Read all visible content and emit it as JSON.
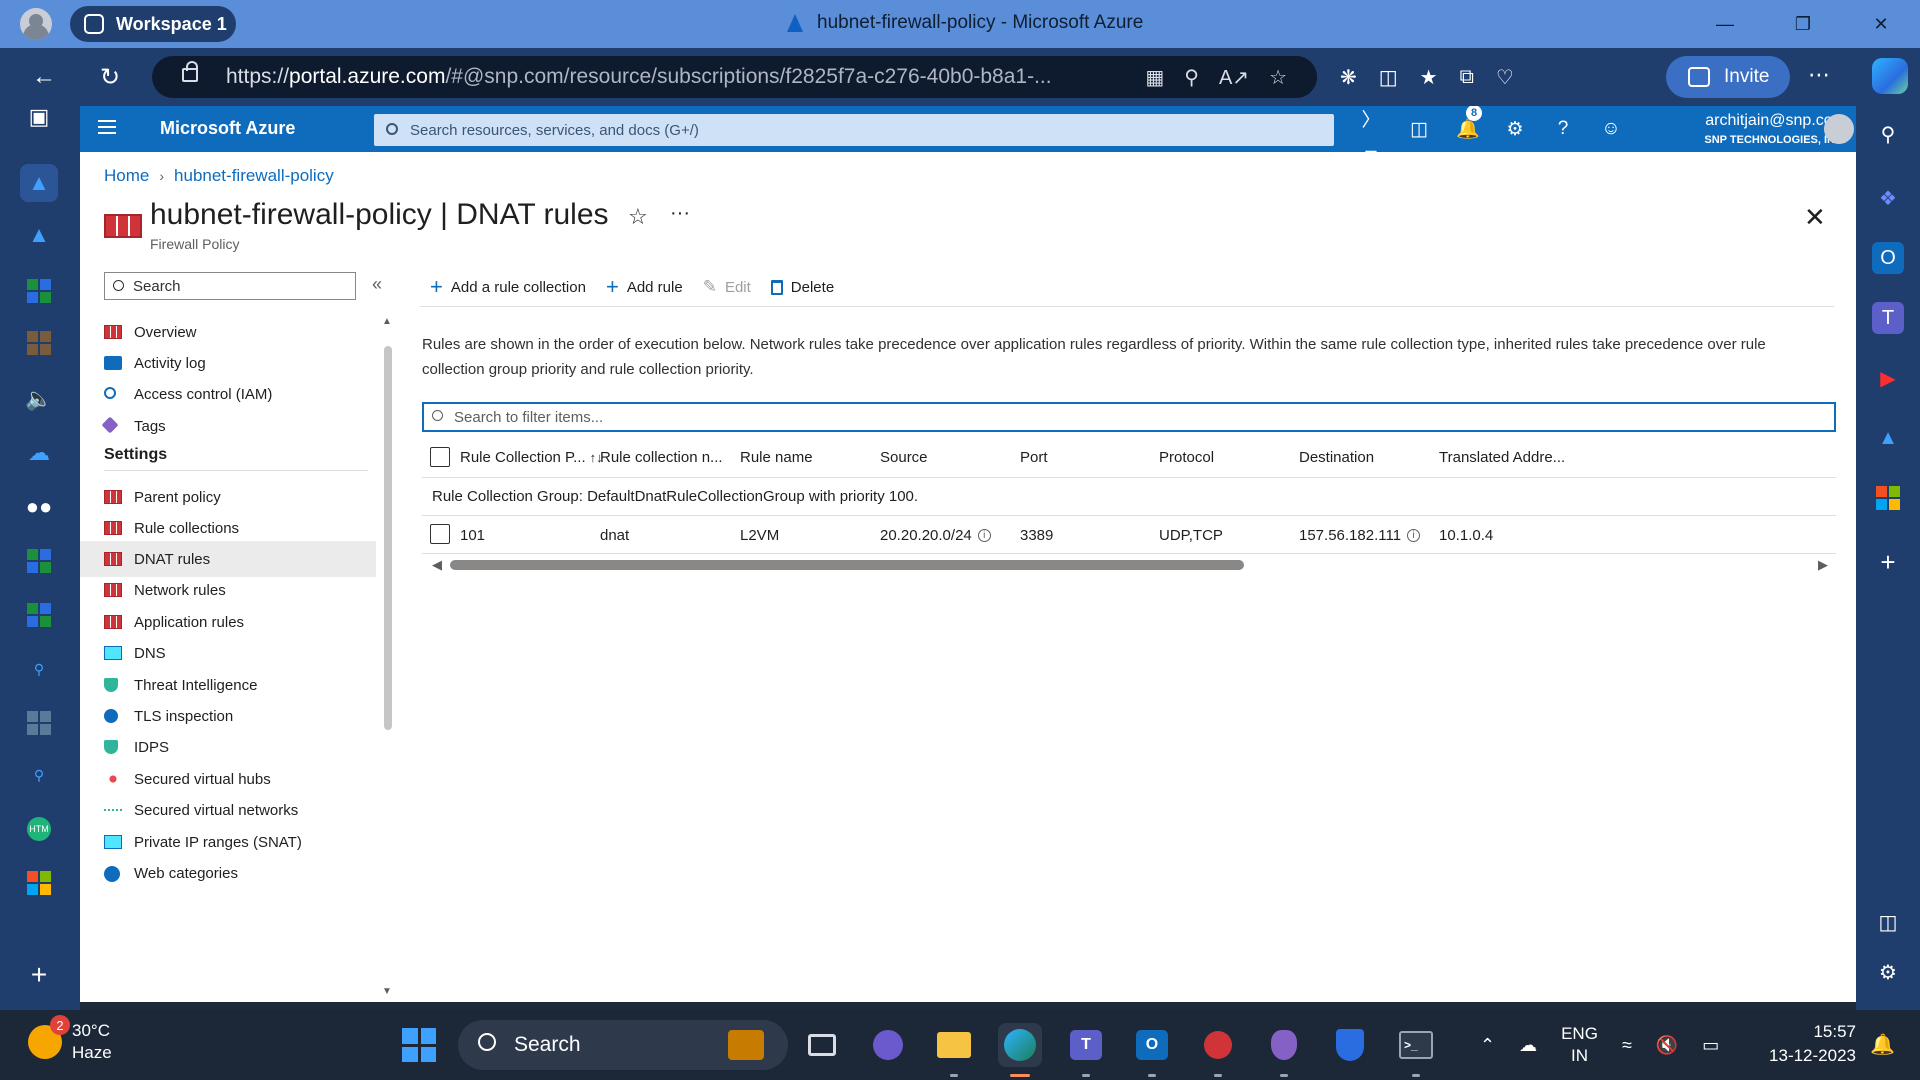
{
  "browser": {
    "workspace": "Workspace 1",
    "tab_title": "hubnet-firewall-policy - Microsoft Azure",
    "url_prefix": "https://",
    "url_host": "portal.azure.com",
    "url_rest": "/#@snp.com/resource/subscriptions/f2825f7a-c276-40b0-b8a1-...",
    "invite_label": "Invite",
    "window_controls": [
      "minimize-icon",
      "restore-icon",
      "close-icon"
    ]
  },
  "portal": {
    "brand": "Microsoft Azure",
    "search_placeholder": "Search resources, services, and docs (G+/)",
    "notification_count": "8",
    "user_email": "architjain@snp.com",
    "user_org": "SNP TECHNOLOGIES, INC."
  },
  "breadcrumb": [
    "Home",
    "hubnet-firewall-policy"
  ],
  "page": {
    "resource_name": "hubnet-firewall-policy",
    "blade_name": "DNAT rules",
    "separator": " | ",
    "subtitle": "Firewall Policy"
  },
  "menu": {
    "search_placeholder": "Search",
    "items_top": [
      {
        "label": "Overview",
        "icon": "firewall-icon"
      },
      {
        "label": "Activity log",
        "icon": "log-icon"
      },
      {
        "label": "Access control (IAM)",
        "icon": "people-icon"
      },
      {
        "label": "Tags",
        "icon": "tag-icon"
      }
    ],
    "section": "Settings",
    "items_settings": [
      {
        "label": "Parent policy",
        "icon": "firewall-icon"
      },
      {
        "label": "Rule collections",
        "icon": "firewall-icon"
      },
      {
        "label": "DNAT rules",
        "icon": "firewall-icon",
        "active": true
      },
      {
        "label": "Network rules",
        "icon": "firewall-icon"
      },
      {
        "label": "Application rules",
        "icon": "firewall-icon"
      },
      {
        "label": "DNS",
        "icon": "dns-icon"
      },
      {
        "label": "Threat Intelligence",
        "icon": "shield-icon"
      },
      {
        "label": "TLS inspection",
        "icon": "tls-icon"
      },
      {
        "label": "IDPS",
        "icon": "shield-icon"
      },
      {
        "label": "Secured virtual hubs",
        "icon": "hub-icon"
      },
      {
        "label": "Secured virtual networks",
        "icon": "vnet-icon"
      },
      {
        "label": "Private IP ranges (SNAT)",
        "icon": "ip-icon"
      },
      {
        "label": "Web categories",
        "icon": "globe-icon"
      }
    ]
  },
  "commands": {
    "add_collection": "Add a rule collection",
    "add_rule": "Add rule",
    "edit": "Edit",
    "delete": "Delete"
  },
  "info_text": "Rules are shown in the order of execution below. Network rules take precedence over application rules regardless of priority. Within the same rule collection type, inherited rules take precedence over rule collection group priority and rule collection priority.",
  "filter_placeholder": "Search to filter items...",
  "grid": {
    "columns": [
      "Rule Collection P...",
      "Rule collection n...",
      "Rule name",
      "Source",
      "Port",
      "Protocol",
      "Destination",
      "Translated Addre..."
    ],
    "group_label": "Rule Collection Group: DefaultDnatRuleCollectionGroup with priority 100.",
    "rows": [
      {
        "priority": "101",
        "collection": "dnat",
        "rule": "L2VM",
        "source": "20.20.20.0/24",
        "port": "3389",
        "protocol": "UDP,TCP",
        "destination": "157.56.182.111",
        "translated": "10.1.0.4"
      }
    ]
  },
  "taskbar": {
    "weather_temp": "30°C",
    "weather_desc": "Haze",
    "weather_badge": "2",
    "search_label": "Search",
    "lang_top": "ENG",
    "lang_bottom": "IN",
    "time": "15:57",
    "date": "13-12-2023"
  }
}
